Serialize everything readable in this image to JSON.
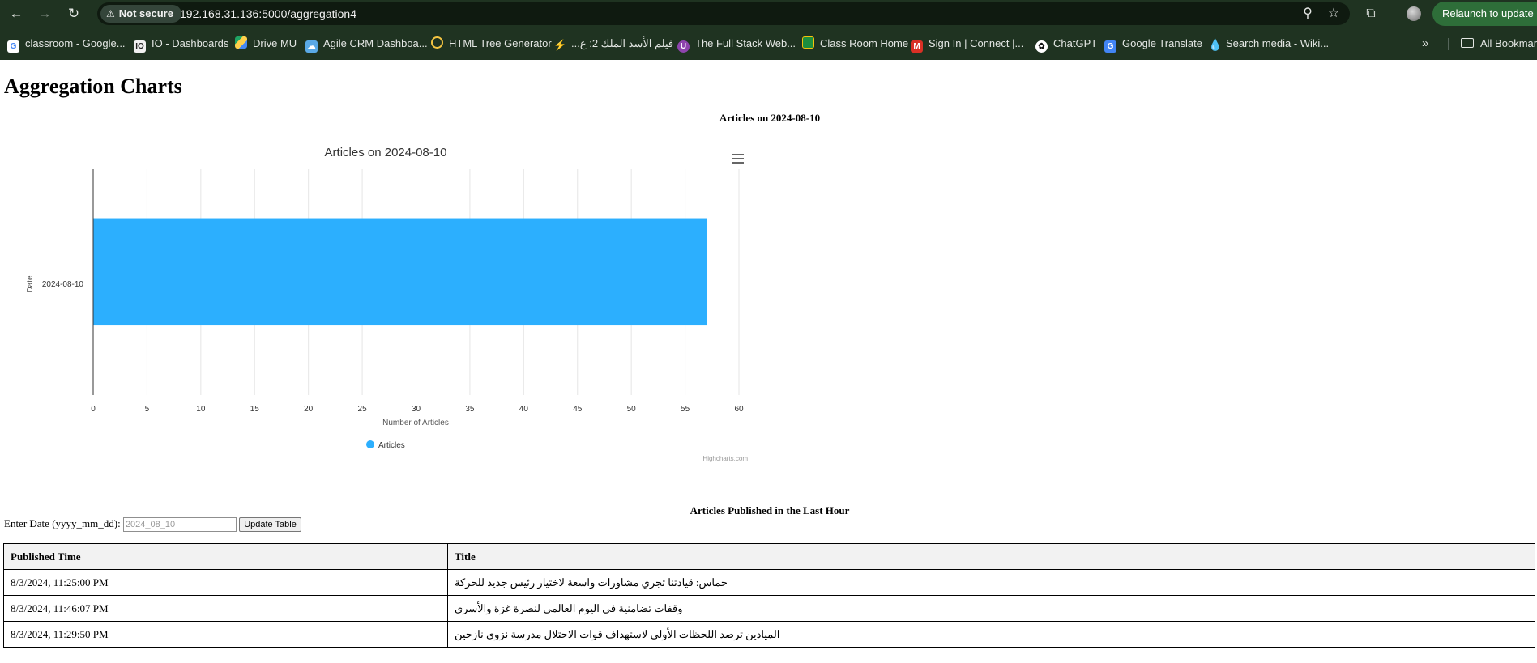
{
  "browser": {
    "security_label": "Not secure",
    "url": "192.168.31.136:5000/aggregation4",
    "relaunch_label": "Relaunch to update",
    "bookmarks": [
      {
        "label": "classroom - Google...",
        "icon": "google-icon",
        "color": "#4285f4"
      },
      {
        "label": "IO - Dashboards",
        "icon": "io-icon",
        "color": "#333333"
      },
      {
        "label": "Drive MU",
        "icon": "google-drive-icon",
        "color": "#1fa463"
      },
      {
        "label": "Agile CRM Dashboa...",
        "icon": "cloud-icon",
        "color": "#5aa9e6"
      },
      {
        "label": "HTML Tree Generator",
        "icon": "circle-icon",
        "color": "#f5c542"
      },
      {
        "label": "فيلم الأسد الملك 2: ع...",
        "icon": "bolt-icon",
        "color": "#f2b705"
      },
      {
        "label": "The Full Stack Web...",
        "icon": "purple-u-icon",
        "color": "#8e44ad"
      },
      {
        "label": "Class Room Home",
        "icon": "classroom-icon",
        "color": "#1e8e3e"
      },
      {
        "label": "Sign In | Connect |...",
        "icon": "m-icon",
        "color": "#d93025"
      },
      {
        "label": "ChatGPT",
        "icon": "chatgpt-icon",
        "color": "#ffffff"
      },
      {
        "label": "Google Translate",
        "icon": "translate-icon",
        "color": "#4285f4"
      },
      {
        "label": "Search media - Wiki...",
        "icon": "wiki-drop-icon",
        "color": "#3a7bd5"
      }
    ],
    "all_bookmarks_label": "All Bookmarks"
  },
  "page": {
    "title": "Aggregation Charts",
    "chart_section_title": "Articles on 2024-08-10",
    "table_section_title": "Articles Published in the Last Hour",
    "date_label": "Enter Date (yyyy_mm_dd):",
    "date_placeholder": "2024_08_10",
    "update_button": "Update Table"
  },
  "chart_data": {
    "type": "bar",
    "orientation": "horizontal",
    "title": "Articles on 2024-08-10",
    "categories": [
      "2024-08-10"
    ],
    "series": [
      {
        "name": "Articles",
        "values": [
          57
        ],
        "color": "#2caffe"
      }
    ],
    "xlabel": "Date",
    "ylabel": "Number of Articles",
    "value_axis_range": [
      0,
      60
    ],
    "value_ticks": [
      0,
      5,
      10,
      15,
      20,
      25,
      30,
      35,
      40,
      45,
      50,
      55,
      60
    ],
    "grid": true,
    "legend": "bottom-center",
    "credits": "Highcharts.com"
  },
  "table": {
    "headers": [
      "Published Time",
      "Title"
    ],
    "rows": [
      [
        "8/3/2024, 11:25:00 PM",
        "حماس: قيادتنا تجري مشاورات واسعة لاختيار رئيس جديد للحركة"
      ],
      [
        "8/3/2024, 11:46:07 PM",
        "وقفات تضامنية في اليوم العالمي لنصرة غزة والأسرى"
      ],
      [
        "8/3/2024, 11:29:50 PM",
        "الميادين ترصد اللحظات الأولى لاستهداف قوات الاحتلال مدرسة نزوي نازحين"
      ]
    ]
  }
}
